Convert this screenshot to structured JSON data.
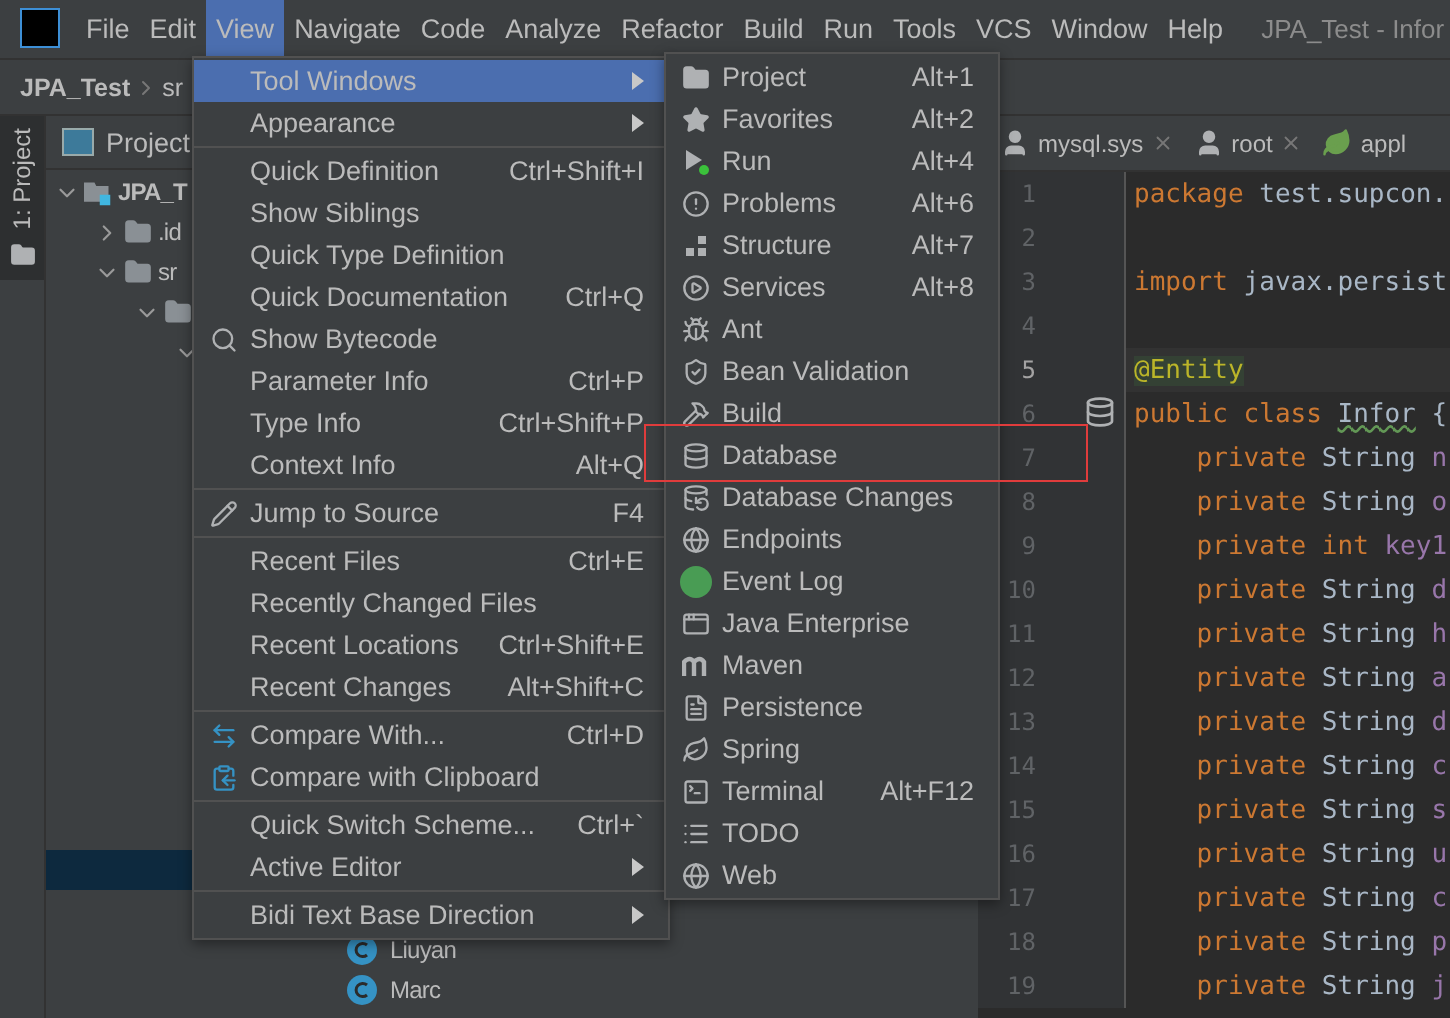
{
  "window": {
    "title": "JPA_Test - Infor"
  },
  "menu_bar": [
    {
      "label": "File",
      "selected": false
    },
    {
      "label": "Edit",
      "selected": false
    },
    {
      "label": "View",
      "selected": true
    },
    {
      "label": "Navigate",
      "selected": false
    },
    {
      "label": "Code",
      "selected": false
    },
    {
      "label": "Analyze",
      "selected": false
    },
    {
      "label": "Refactor",
      "selected": false
    },
    {
      "label": "Build",
      "selected": false
    },
    {
      "label": "Run",
      "selected": false
    },
    {
      "label": "Tools",
      "selected": false
    },
    {
      "label": "VCS",
      "selected": false
    },
    {
      "label": "Window",
      "selected": false
    },
    {
      "label": "Help",
      "selected": false
    }
  ],
  "breadcrumbs": [
    "JPA_Test",
    "sr"
  ],
  "side_stripe": {
    "label": "1: Project"
  },
  "project_panel": {
    "title": "Project",
    "tree": [
      {
        "label": "JPA_T",
        "expanded": true,
        "children": [
          {
            "label": ".id",
            "expanded": false
          },
          {
            "label": "sr",
            "expanded": true,
            "children": [
              {
                "expanded": true,
                "children": [
                  {
                    "expanded": true
                  }
                ]
              }
            ]
          }
        ]
      }
    ],
    "lower_rows": [
      {
        "selected": true
      },
      {
        "selected": false
      },
      {
        "label": "Liuyan",
        "selected": false
      },
      {
        "label": "Marc",
        "selected": false
      }
    ]
  },
  "editor": {
    "tabs": [
      {
        "label": "mysql.sys",
        "kind": "user",
        "closable": true
      },
      {
        "label": "root",
        "kind": "user",
        "closable": true
      },
      {
        "label": "appl",
        "kind": "spring",
        "closable": false
      }
    ],
    "lines": [
      {
        "number": "1",
        "current": false,
        "tokens": [
          {
            "text": "package ",
            "kind": "keyword"
          },
          {
            "text": "test.supcon.",
            "kind": "plain"
          }
        ]
      },
      {
        "number": "2",
        "current": false
      },
      {
        "number": "3",
        "current": false,
        "tokens": [
          {
            "text": "import ",
            "kind": "keyword"
          },
          {
            "text": "javax.persist",
            "kind": "plain"
          }
        ]
      },
      {
        "number": "4",
        "current": false
      },
      {
        "number": "5",
        "current": true,
        "tokens": [
          {
            "text": "@Entity",
            "kind": "annotation"
          }
        ]
      },
      {
        "number": "6",
        "current": false,
        "gutter_icon": true,
        "tokens": [
          {
            "text": "public class ",
            "kind": "keyword"
          },
          {
            "text": "Infor",
            "kind": "class"
          },
          {
            "text": " {",
            "kind": "plain"
          }
        ]
      },
      {
        "number": "7",
        "current": false,
        "tokens": [
          {
            "text": "    private ",
            "kind": "keyword"
          },
          {
            "text": "String ",
            "kind": "plain"
          },
          {
            "text": "n",
            "kind": "field"
          }
        ]
      },
      {
        "number": "8",
        "current": false,
        "tokens": [
          {
            "text": "    private ",
            "kind": "keyword"
          },
          {
            "text": "String ",
            "kind": "plain"
          },
          {
            "text": "o",
            "kind": "field"
          }
        ]
      },
      {
        "number": "9",
        "current": false,
        "tokens": [
          {
            "text": "    private ",
            "kind": "keyword"
          },
          {
            "text": "int ",
            "kind": "type"
          },
          {
            "text": "key1",
            "kind": "field"
          }
        ]
      },
      {
        "number": "10",
        "current": false,
        "tokens": [
          {
            "text": "    private ",
            "kind": "keyword"
          },
          {
            "text": "String ",
            "kind": "plain"
          },
          {
            "text": "d",
            "kind": "field"
          }
        ]
      },
      {
        "number": "11",
        "current": false,
        "tokens": [
          {
            "text": "    private ",
            "kind": "keyword"
          },
          {
            "text": "String ",
            "kind": "plain"
          },
          {
            "text": "h",
            "kind": "field"
          }
        ]
      },
      {
        "number": "12",
        "current": false,
        "tokens": [
          {
            "text": "    private ",
            "kind": "keyword"
          },
          {
            "text": "String ",
            "kind": "plain"
          },
          {
            "text": "a",
            "kind": "field"
          }
        ]
      },
      {
        "number": "13",
        "current": false,
        "tokens": [
          {
            "text": "    private ",
            "kind": "keyword"
          },
          {
            "text": "String ",
            "kind": "plain"
          },
          {
            "text": "d",
            "kind": "field"
          }
        ]
      },
      {
        "number": "14",
        "current": false,
        "tokens": [
          {
            "text": "    private ",
            "kind": "keyword"
          },
          {
            "text": "String ",
            "kind": "plain"
          },
          {
            "text": "c",
            "kind": "field"
          }
        ]
      },
      {
        "number": "15",
        "current": false,
        "tokens": [
          {
            "text": "    private ",
            "kind": "keyword"
          },
          {
            "text": "String ",
            "kind": "plain"
          },
          {
            "text": "s",
            "kind": "field"
          }
        ]
      },
      {
        "number": "16",
        "current": false,
        "tokens": [
          {
            "text": "    private ",
            "kind": "keyword"
          },
          {
            "text": "String ",
            "kind": "plain"
          },
          {
            "text": "u",
            "kind": "field"
          }
        ]
      },
      {
        "number": "17",
        "current": false,
        "tokens": [
          {
            "text": "    private ",
            "kind": "keyword"
          },
          {
            "text": "String ",
            "kind": "plain"
          },
          {
            "text": "c",
            "kind": "field"
          }
        ]
      },
      {
        "number": "18",
        "current": false,
        "tokens": [
          {
            "text": "    private ",
            "kind": "keyword"
          },
          {
            "text": "String ",
            "kind": "plain"
          },
          {
            "text": "p",
            "kind": "field"
          }
        ]
      },
      {
        "number": "19",
        "current": false,
        "tokens": [
          {
            "text": "    private ",
            "kind": "keyword"
          },
          {
            "text": "String ",
            "kind": "plain"
          },
          {
            "text": "j",
            "kind": "field"
          }
        ]
      }
    ]
  },
  "view_menu": {
    "groups": [
      [
        {
          "label": "Tool Windows",
          "selected": true,
          "submenu": true
        },
        {
          "label": "Appearance",
          "selected": false,
          "submenu": true
        }
      ],
      [
        {
          "label": "Quick Definition",
          "shortcut": "Ctrl+Shift+I",
          "selected": false
        },
        {
          "label": "Show Siblings",
          "selected": false
        },
        {
          "label": "Quick Type Definition",
          "selected": false
        },
        {
          "label": "Quick Documentation",
          "shortcut": "Ctrl+Q",
          "selected": false
        },
        {
          "label": "Show Bytecode",
          "selected": false
        },
        {
          "label": "Parameter Info",
          "shortcut": "Ctrl+P",
          "selected": false
        },
        {
          "label": "Type Info",
          "shortcut": "Ctrl+Shift+P",
          "selected": false
        },
        {
          "label": "Context Info",
          "shortcut": "Alt+Q",
          "selected": false
        }
      ],
      [
        {
          "label": "Jump to Source",
          "shortcut": "F4",
          "selected": false
        }
      ],
      [
        {
          "label": "Recent Files",
          "shortcut": "Ctrl+E",
          "selected": false
        },
        {
          "label": "Recently Changed Files",
          "selected": false
        },
        {
          "label": "Recent Locations",
          "shortcut": "Ctrl+Shift+E",
          "selected": false
        },
        {
          "label": "Recent Changes",
          "shortcut": "Alt+Shift+C",
          "selected": false
        }
      ],
      [
        {
          "label": "Compare With...",
          "shortcut": "Ctrl+D",
          "selected": false
        },
        {
          "label": "Compare with Clipboard",
          "selected": false
        }
      ],
      [
        {
          "label": "Quick Switch Scheme...",
          "shortcut": "Ctrl+`",
          "selected": false
        },
        {
          "label": "Active Editor",
          "selected": false,
          "submenu": true
        }
      ],
      [
        {
          "label": "Bidi Text Base Direction",
          "selected": false,
          "submenu": true
        }
      ]
    ]
  },
  "tool_windows_menu": [
    {
      "label": "Project",
      "shortcut": "Alt+1"
    },
    {
      "label": "Favorites",
      "shortcut": "Alt+2"
    },
    {
      "label": "Run",
      "shortcut": "Alt+4"
    },
    {
      "label": "Problems",
      "shortcut": "Alt+6"
    },
    {
      "label": "Structure",
      "shortcut": "Alt+7"
    },
    {
      "label": "Services",
      "shortcut": "Alt+8"
    },
    {
      "label": "Ant"
    },
    {
      "label": "Bean Validation"
    },
    {
      "label": "Build"
    },
    {
      "label": "Database"
    },
    {
      "label": "Database Changes"
    },
    {
      "label": "Endpoints"
    },
    {
      "label": "Event Log"
    },
    {
      "label": "Java Enterprise"
    },
    {
      "label": "Maven"
    },
    {
      "label": "Persistence"
    },
    {
      "label": "Spring"
    },
    {
      "label": "Terminal",
      "shortcut": "Alt+F12"
    },
    {
      "label": "TODO"
    },
    {
      "label": "Web"
    }
  ],
  "annotation": {
    "kind": "highlight-frame"
  }
}
